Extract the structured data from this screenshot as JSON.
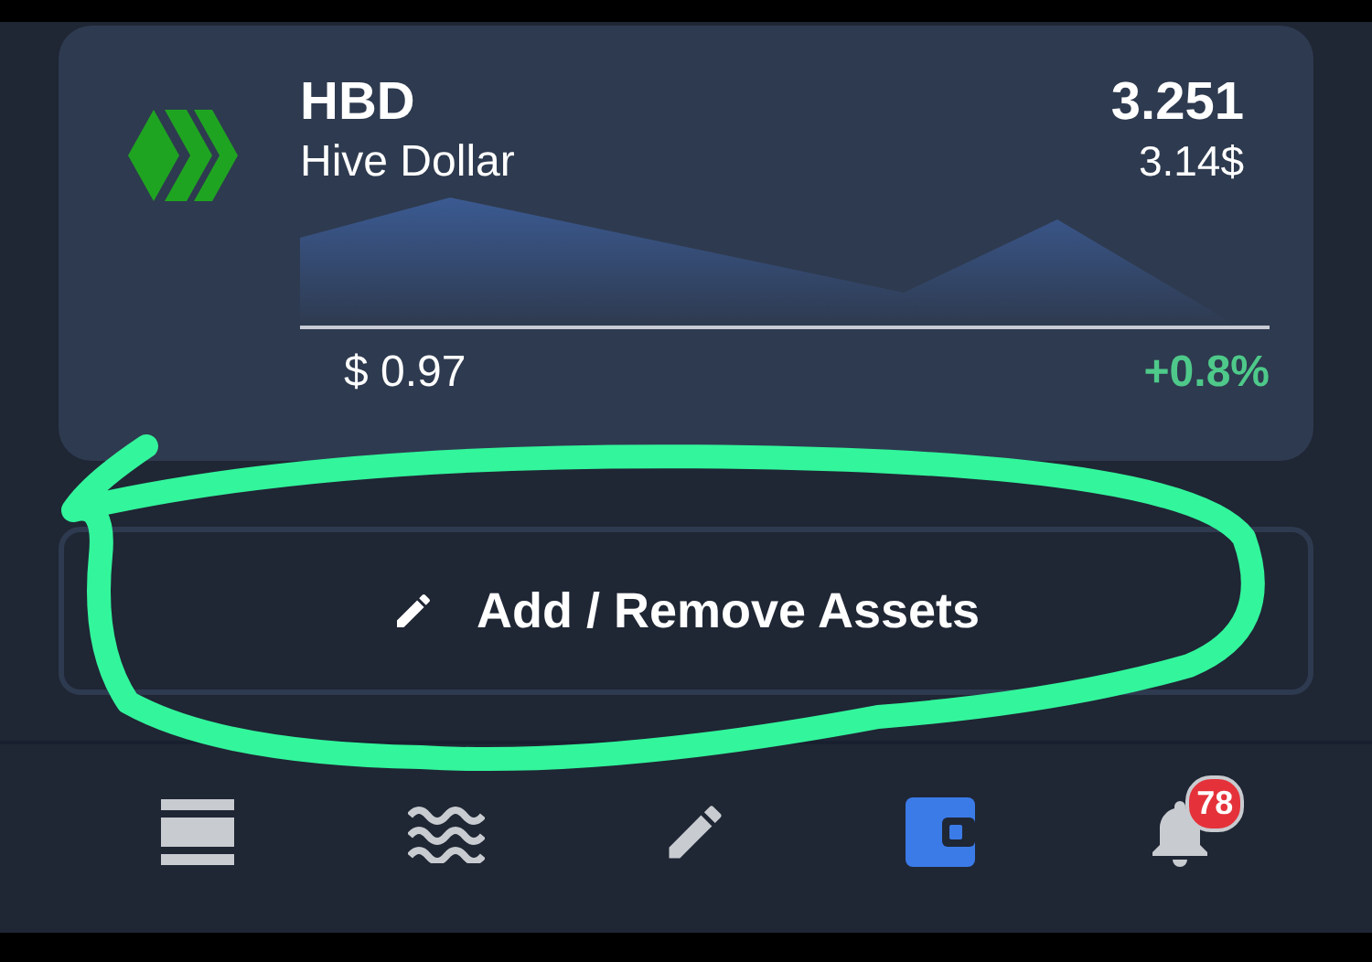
{
  "asset": {
    "symbol": "HBD",
    "name": "Hive Dollar",
    "balance": "3.251",
    "value": "3.14$",
    "price": "$ 0.97",
    "change": "+0.8%"
  },
  "action_button": {
    "label": "Add / Remove Assets"
  },
  "nav": [
    {
      "kind": "feed",
      "selected": false
    },
    {
      "kind": "waves",
      "selected": false
    },
    {
      "kind": "post",
      "selected": false
    },
    {
      "kind": "wallet",
      "selected": true
    },
    {
      "kind": "notifications",
      "selected": false,
      "badge": "78"
    }
  ]
}
